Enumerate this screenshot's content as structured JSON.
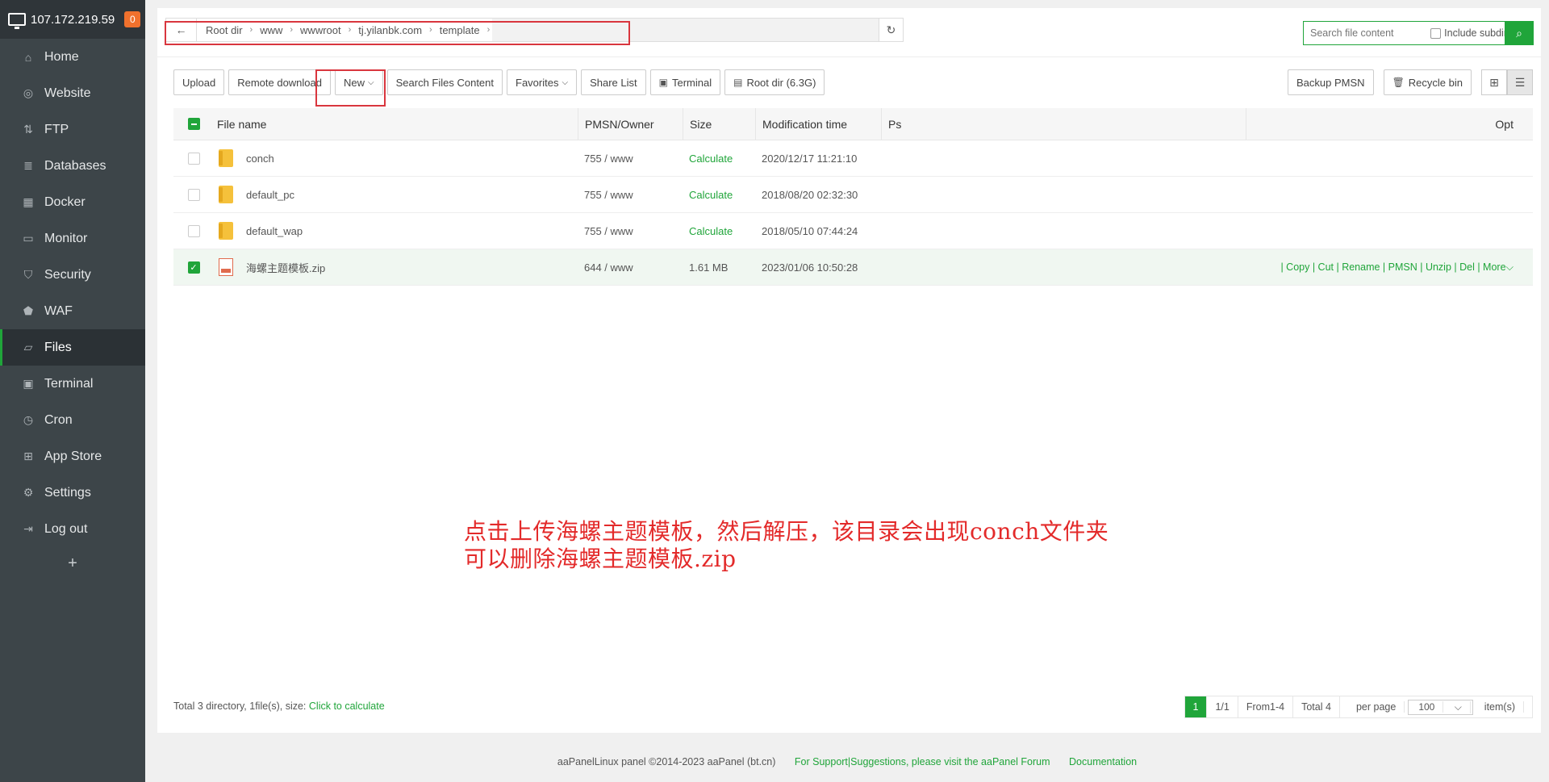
{
  "sidebar": {
    "server_ip": "107.172.219.59",
    "badge": "0",
    "items": [
      {
        "label": "Home",
        "icon": "home-icon",
        "glyph": "⌂"
      },
      {
        "label": "Website",
        "icon": "globe-icon",
        "glyph": "◎"
      },
      {
        "label": "FTP",
        "icon": "ftp-icon",
        "glyph": "⇅"
      },
      {
        "label": "Databases",
        "icon": "database-icon",
        "glyph": "≣"
      },
      {
        "label": "Docker",
        "icon": "docker-icon",
        "glyph": "▦"
      },
      {
        "label": "Monitor",
        "icon": "monitor-icon",
        "glyph": "▭"
      },
      {
        "label": "Security",
        "icon": "shield-icon",
        "glyph": "⛉"
      },
      {
        "label": "WAF",
        "icon": "waf-shield-icon",
        "glyph": "⬟"
      },
      {
        "label": "Files",
        "icon": "folder-icon",
        "glyph": "▱"
      },
      {
        "label": "Terminal",
        "icon": "terminal-icon",
        "glyph": "▣"
      },
      {
        "label": "Cron",
        "icon": "clock-icon",
        "glyph": "◷"
      },
      {
        "label": "App Store",
        "icon": "apps-icon",
        "glyph": "⊞"
      },
      {
        "label": "Settings",
        "icon": "gear-icon",
        "glyph": "⚙"
      },
      {
        "label": "Log out",
        "icon": "logout-icon",
        "glyph": "⇥"
      }
    ],
    "active": "Files",
    "add_glyph": "+"
  },
  "path": {
    "back_glyph": "←",
    "crumbs": [
      "Root dir",
      "www",
      "wwwroot",
      "tj.yilanbk.com",
      "template"
    ],
    "refresh_glyph": "↻"
  },
  "search": {
    "placeholder": "Search file content",
    "include_subdir": "Include subdir",
    "button_glyph": "⌕"
  },
  "toolbar": {
    "upload": "Upload",
    "remote_download": "Remote download",
    "new": "New",
    "search_files_content": "Search Files Content",
    "favorites": "Favorites",
    "share_list": "Share List",
    "terminal": "Terminal",
    "root_dir": "Root dir (6.3G)",
    "backup_pmsn": "Backup PMSN",
    "recycle_bin": "Recycle bin",
    "caret": "⌵",
    "terminal_glyph": "▣",
    "disk_glyph": "▤",
    "trash_glyph": "🗑",
    "grid_glyph": "⊞",
    "list_glyph": "☰"
  },
  "table": {
    "headers": {
      "name": "File name",
      "perm": "PMSN/Owner",
      "size": "Size",
      "time": "Modification time",
      "ps": "Ps",
      "opt": "Opt"
    },
    "rows": [
      {
        "name": "conch",
        "perm": "755 / www",
        "size": "Calculate",
        "time": "2020/12/17 11:21:10",
        "type": "folder",
        "selected": false
      },
      {
        "name": "default_pc",
        "perm": "755 / www",
        "size": "Calculate",
        "time": "2018/08/20 02:32:30",
        "type": "folder",
        "selected": false
      },
      {
        "name": "default_wap",
        "perm": "755 / www",
        "size": "Calculate",
        "time": "2018/05/10 07:44:24",
        "type": "folder",
        "selected": false
      },
      {
        "name": "海螺主题模板.zip",
        "perm": "644 / www",
        "size": "1.61 MB",
        "time": "2023/01/06 10:50:28",
        "type": "zip",
        "selected": true,
        "ops": "| Copy | Cut | Rename | PMSN | Unzip | Del | More⌵"
      }
    ]
  },
  "annotation": {
    "line1": "点击上传海螺主题模板，然后解压，该目录会出现conch文件夹",
    "line2": "可以删除海螺主题模板.zip"
  },
  "footer": {
    "summary": "Total 3 directory, 1file(s), size:",
    "calc_link": "Click to calculate",
    "page_current": "1",
    "page_of": "1/1",
    "range": "From1-4",
    "total": "Total 4",
    "per_page": "per page",
    "per_page_value": "100",
    "items": "item(s)"
  },
  "copyright": {
    "text": "aaPanelLinux panel ©2014-2023 aaPanel (bt.cn)",
    "support": "For Support|Suggestions, please visit the aaPanel Forum",
    "docs": "Documentation"
  },
  "colors": {
    "accent": "#20a53a",
    "highlight_box": "#d9363e",
    "annotation": "#e32a2a"
  }
}
